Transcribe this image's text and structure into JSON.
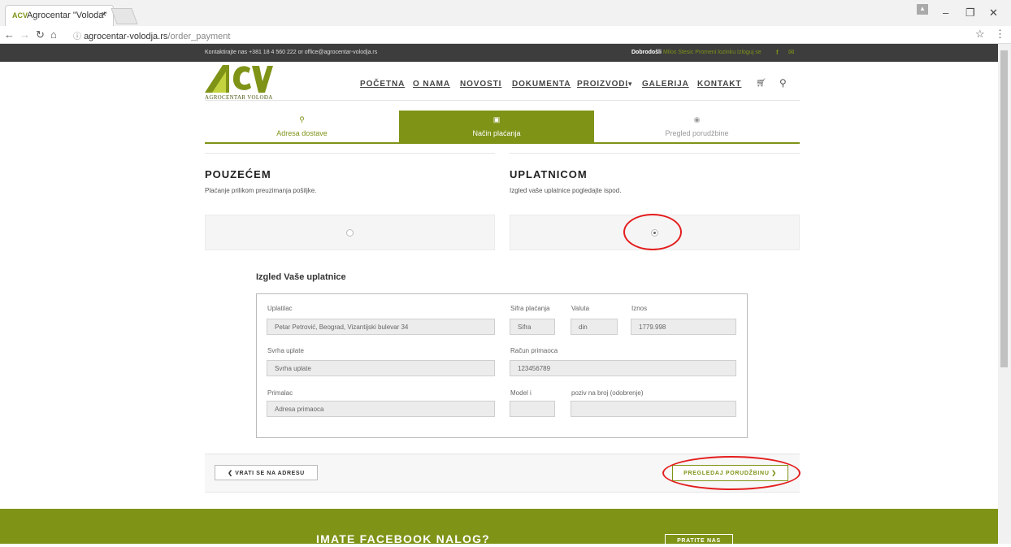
{
  "browser": {
    "tab_title": "Agrocentar \"Voloda\"",
    "tab_favicon": "ACV",
    "tab_close": "×",
    "url_host": "agrocentar-volodja.rs",
    "url_path": "/order_payment",
    "icons": [
      "back-icon",
      "forward-icon",
      "reload-icon",
      "home-icon",
      "info-icon",
      "star-icon",
      "menu-icon",
      "profile-icon",
      "minimize-icon",
      "maximize-icon",
      "close-icon"
    ]
  },
  "topbar": {
    "contact": "Kontaktirajte nas +381 18 4 560 222 or office@agrocentar-volodja.rs",
    "welcome": "Dobrodošli",
    "user_links": "Milos Stesic Promeni lozinku Izloguj se",
    "icons": [
      "facebook-icon",
      "mail-icon"
    ]
  },
  "header": {
    "logo_mark": "ACV",
    "logo_text": "AGROCENTAR VOLOĐA",
    "nav": [
      "POČETNA",
      "O NAMA",
      "NOVOSTI",
      "DOKUMENTA",
      "PROIZVODI",
      "GALERIJA",
      "KONTAKT"
    ],
    "dropdown_glyph": "▾",
    "icons": [
      "cart-icon",
      "search-icon"
    ]
  },
  "steps": [
    {
      "label": "Adresa dostave",
      "icon": "location-pin-icon",
      "state": "done"
    },
    {
      "label": "Način plaćanja",
      "icon": "money-icon",
      "state": "active"
    },
    {
      "label": "Pregled porudžbine",
      "icon": "eye-icon",
      "state": "pending"
    }
  ],
  "payment": {
    "cod_title": "POUZEĆEM",
    "cod_desc": "Plaćanje prilikom preuzimanja pošiljke.",
    "slip_title": "UPLATNICOM",
    "slip_desc": "Izgled vaše uplatnice pogledajte ispod.",
    "selected": "UPLATNICOM"
  },
  "uplatnica": {
    "heading": "Izgled Vaše uplatnice",
    "uplatilac_label": "Uplatilac",
    "uplatilac_value": "Petar Petrović, Beograd, Vizantijski bulevar 34",
    "sifra_label": "Sifra plaćanja",
    "sifra_value": "Sifra",
    "valuta_label": "Valuta",
    "valuta_value": "din",
    "iznos_label": "Iznos",
    "iznos_value": "1779.998",
    "svrha_label": "Svrha uplate",
    "svrha_value": "Svrha uplate",
    "racun_label": "Račun primaoca",
    "racun_value": "123456789",
    "primalac_label": "Primalac",
    "primalac_value": "Adresa primaoca",
    "model_label": "Model i",
    "model_value": "",
    "poziv_label": "poziv na broj (odobrenje)",
    "poziv_value": ""
  },
  "actions": {
    "back": "VRATI SE NA ADRESU",
    "back_glyph": "❮",
    "next": "PREGLEDAJ PORUDŽBINU",
    "next_glyph": "❯"
  },
  "footer": {
    "title": "IMATE FACEBOOK NALOG?",
    "button": "PRATITE NAS"
  },
  "colors": {
    "accent": "#7f9317",
    "topbar": "#3d3d3d",
    "annotation": "#e41d1d"
  }
}
